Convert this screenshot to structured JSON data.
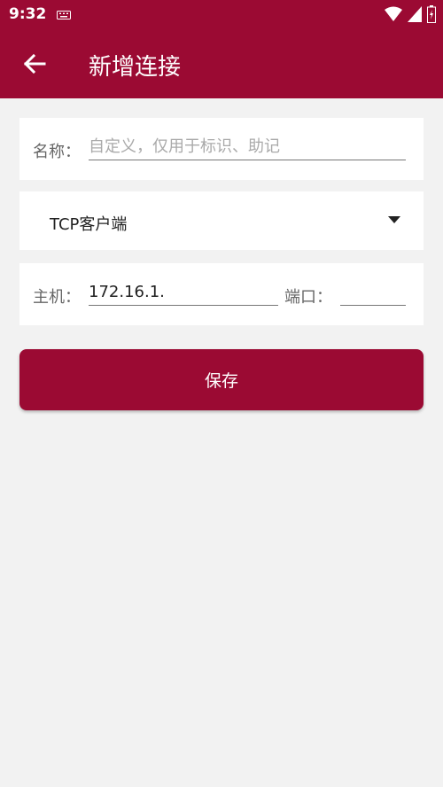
{
  "status": {
    "time": "9:32"
  },
  "header": {
    "title": "新增连接"
  },
  "form": {
    "name_label": "名称：",
    "name_placeholder": "自定义，仅用于标识、助记",
    "type_value": "TCP客户端",
    "host_label": "主机：",
    "host_value": "172.16.1.",
    "port_label": "端口：",
    "port_value": ""
  },
  "actions": {
    "save_label": "保存"
  },
  "colors": {
    "primary": "#9b0a33",
    "background": "#f2f2f2"
  },
  "icons": [
    "back-arrow-icon",
    "keyboard-icon",
    "wifi-icon",
    "signal-icon",
    "battery-icon",
    "dropdown-icon"
  ]
}
